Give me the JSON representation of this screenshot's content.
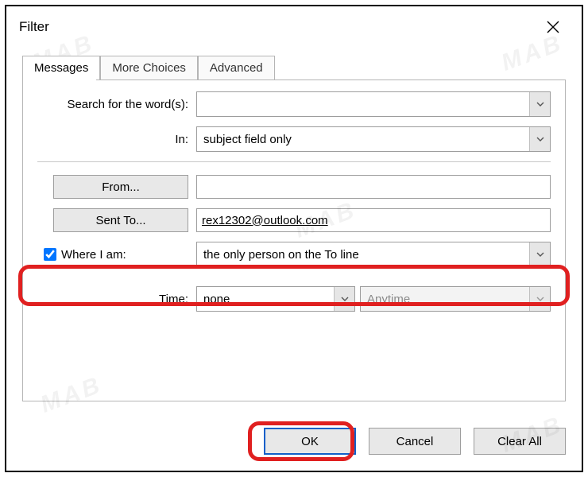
{
  "dialog": {
    "title": "Filter"
  },
  "tabs": {
    "messages": "Messages",
    "more_choices": "More Choices",
    "advanced": "Advanced"
  },
  "fields": {
    "search_label": "Search for the word(s):",
    "search_value": "",
    "in_label": "In:",
    "in_value": "subject field only",
    "from_button": "From...",
    "from_value": "",
    "sent_to_button": "Sent To...",
    "sent_to_value": "rex12302@outlook.com",
    "where_i_am_label": "Where I am:",
    "where_i_am_checked": true,
    "where_i_am_value": "the only person on the To line",
    "time_label": "Time:",
    "time_value": "none",
    "time_range_value": "Anytime"
  },
  "buttons": {
    "ok": "OK",
    "cancel": "Cancel",
    "clear_all": "Clear All"
  },
  "watermark": "MAB"
}
